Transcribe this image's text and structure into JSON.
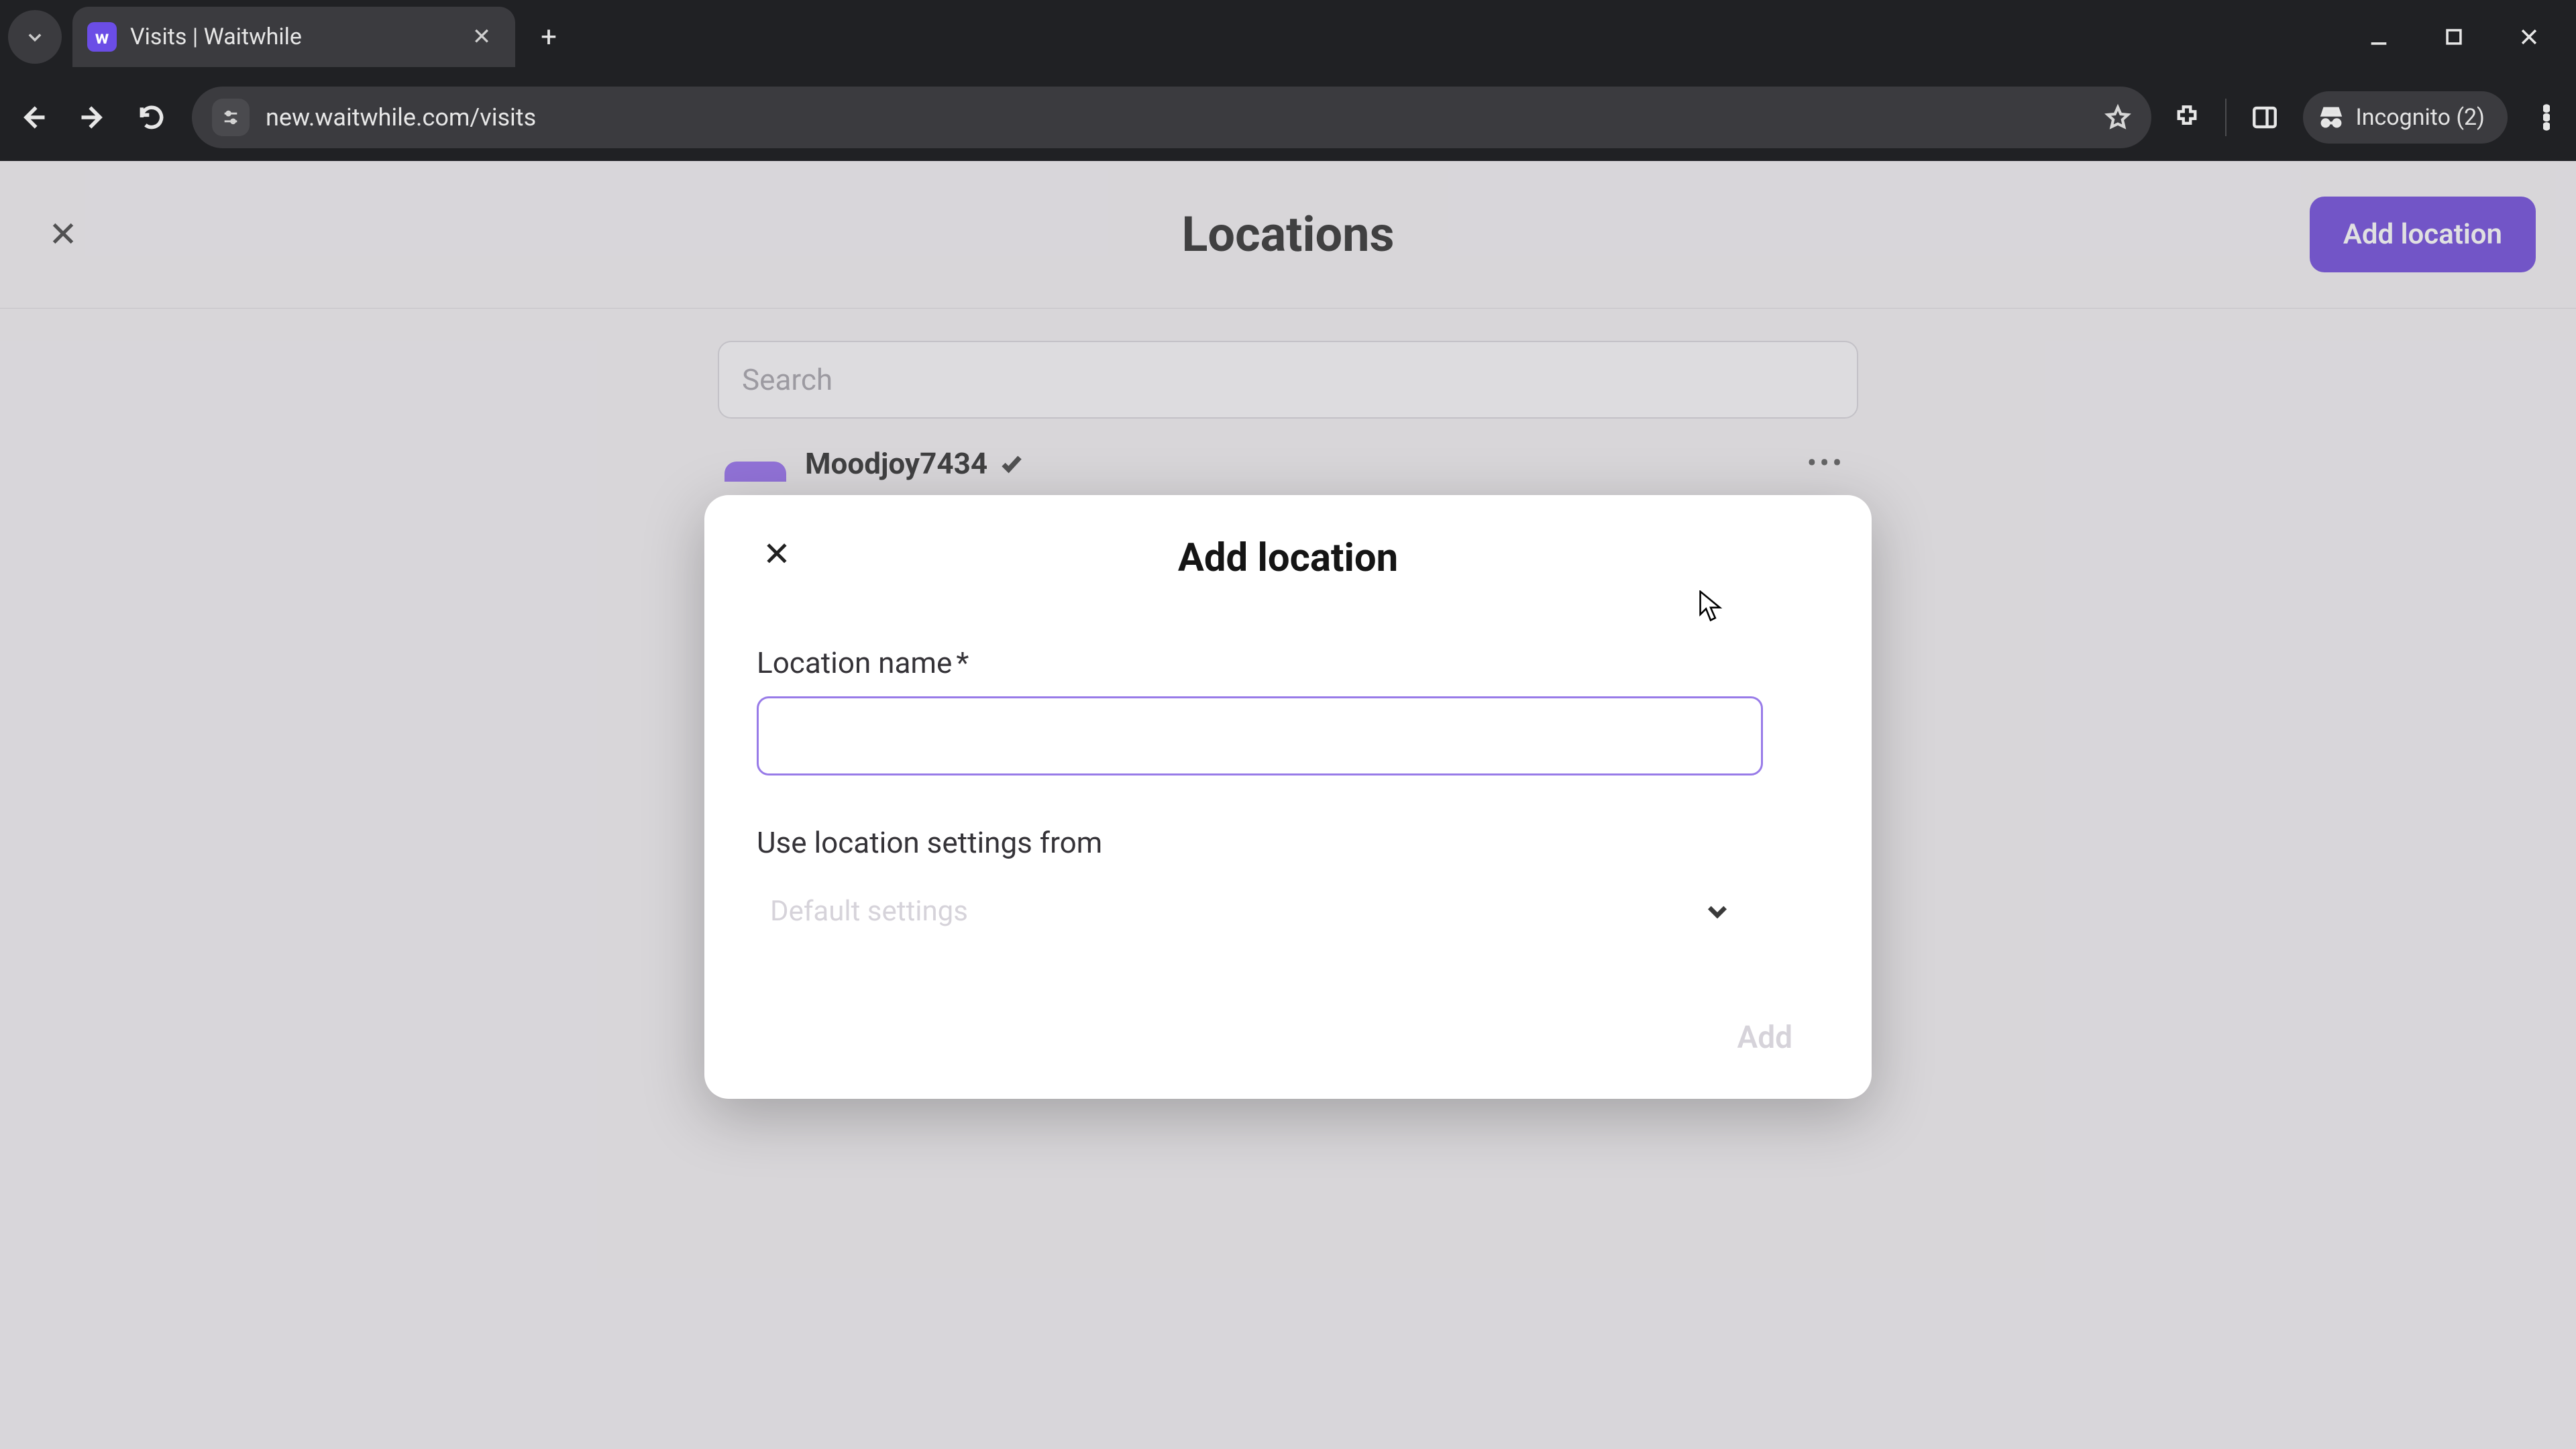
{
  "browser": {
    "tab_title": "Visits | Waitwhile",
    "url": "new.waitwhile.com/visits",
    "incognito_label": "Incognito (2)"
  },
  "page": {
    "title": "Locations",
    "add_button": "Add location",
    "search_placeholder": "Search",
    "list": {
      "item_name": "Moodjoy7434"
    }
  },
  "modal": {
    "title": "Add location",
    "location_name_label": "Location name",
    "required_mark": "*",
    "location_name_value": "",
    "use_settings_label": "Use location settings from",
    "use_settings_value": "Default settings",
    "submit_label": "Add"
  },
  "colors": {
    "accent": "#5b31d8",
    "input_focus": "#987be8"
  }
}
